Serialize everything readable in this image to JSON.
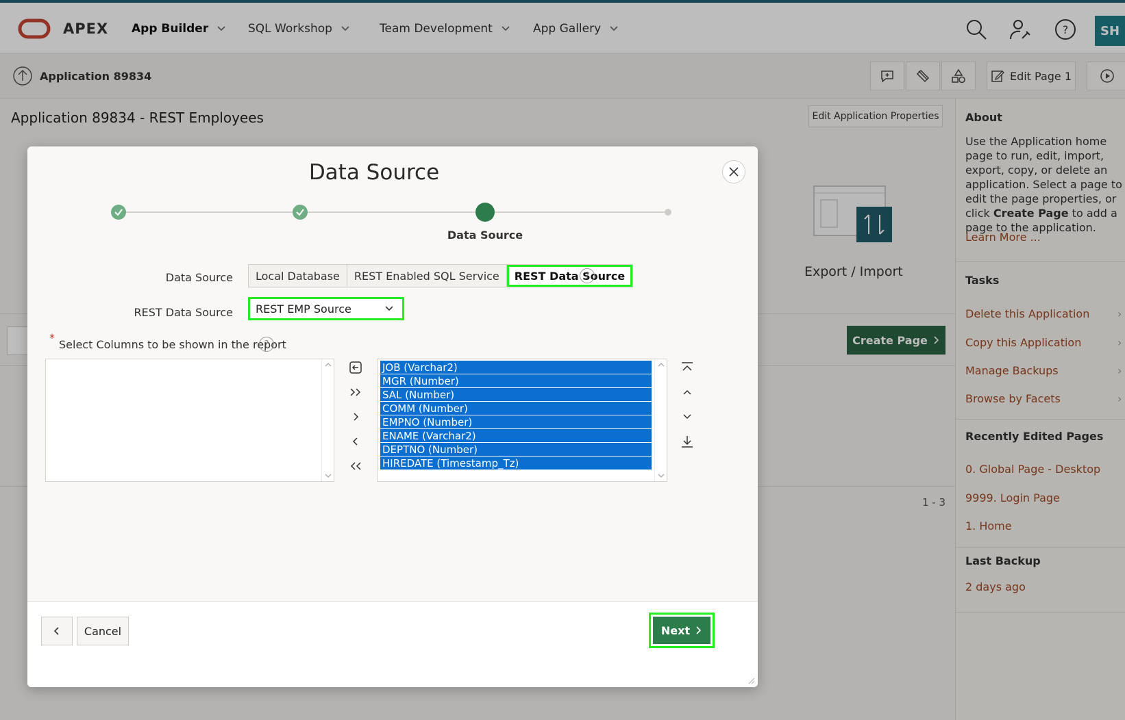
{
  "header": {
    "brand": "APEX",
    "nav": [
      {
        "label": "App Builder",
        "active": true
      },
      {
        "label": "SQL Workshop",
        "active": false
      },
      {
        "label": "Team Development",
        "active": false
      },
      {
        "label": "App Gallery",
        "active": false
      }
    ],
    "avatar_initials": "SH",
    "icons": [
      "search-icon",
      "user-wrench-icon",
      "help-icon"
    ]
  },
  "subbar": {
    "app_label": "Application 89834",
    "edit_page_label": "Edit Page 1",
    "icons": [
      "comment-icon",
      "pin-icon",
      "shapes-icon",
      "edit-icon",
      "run-icon"
    ]
  },
  "page": {
    "title": "Application 89834 - REST Employees",
    "edit_props_label": "Edit Application Properties",
    "export_label": "Export / Import",
    "create_page_label": "Create Page",
    "pagination": "1 - 3"
  },
  "sidebar": {
    "about_heading": "About",
    "about_text_1": "Use the Application home page to run, edit, import, export, copy, or delete an application. Select a page to edit the page properties, or click ",
    "about_text_bold": "Create Page",
    "about_text_2": " to add a page to the application.",
    "learn_more": "Learn More ...",
    "tasks_heading": "Tasks",
    "tasks": [
      "Delete this Application",
      "Copy this Application",
      "Manage Backups",
      "Browse by Facets"
    ],
    "recent_heading": "Recently Edited Pages",
    "recent": [
      "0. Global Page - Desktop",
      "9999. Login Page",
      "1. Home"
    ],
    "backup_heading": "Last Backup",
    "backup_value": "2 days ago"
  },
  "dialog": {
    "title": "Data Source",
    "current_step_label": "Data Source",
    "data_source_label": "Data Source",
    "data_source_options": [
      "Local Database",
      "REST Enabled SQL Service",
      "REST Data Source"
    ],
    "data_source_selected": "REST Data Source",
    "rest_source_label": "REST Data Source",
    "rest_source_value": "REST EMP Source",
    "columns_label": "Select Columns to be shown in the report",
    "required_marker": "*",
    "help_glyph": "?",
    "selected_columns": [
      "JOB (Varchar2)",
      "MGR (Number)",
      "SAL (Number)",
      "COMM (Number)",
      "EMPNO (Number)",
      "ENAME (Varchar2)",
      "DEPTNO (Number)",
      "HIREDATE (Timestamp_Tz)"
    ],
    "shuttle_controls": [
      "reset-icon",
      "move-all-icon",
      "move-icon",
      "remove-icon",
      "remove-all-icon"
    ],
    "order_controls": [
      "move-top-icon",
      "move-up-icon",
      "move-down-icon",
      "move-bottom-icon"
    ],
    "cancel_label": "Cancel",
    "next_label": "Next"
  },
  "colors": {
    "accent_green": "#2d7c4c",
    "highlight": "#22ee22",
    "selection_blue": "#0a6fd0",
    "link": "#a14a24"
  }
}
